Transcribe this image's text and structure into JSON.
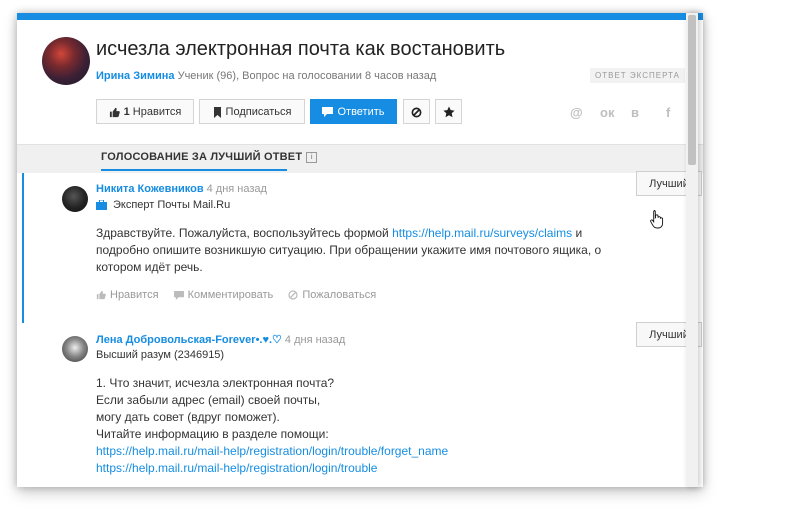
{
  "question": {
    "title": "исчезла электронная почта как востановить",
    "author": "Ирина Зимина",
    "meta": " Ученик (96), Вопрос на голосовании 8 часов назад",
    "expert_badge": "ОТВЕТ ЭКСПЕРТА"
  },
  "toolbar": {
    "like_count": "1",
    "like_label": " Нравится",
    "subscribe_label": "Подписаться",
    "answer_label": "Ответить"
  },
  "social": [
    "@",
    "ок",
    "в",
    "f"
  ],
  "vote_section": {
    "title": "ГОЛОСОВАНИЕ ЗА ЛУЧШИЙ ОТВЕТ",
    "info": "i"
  },
  "answers": [
    {
      "author": "Никита Кожевников",
      "time": "4 дня назад",
      "rank": "Эксперт Почты Mail.Ru",
      "body_prefix": "Здравствуйте. Пожалуйста, воспользуйтесь формой ",
      "link": "https://help.mail.ru/surveys/claims",
      "body_suffix": " и подробно опишите возникшую ситуацию. При обращении укажите имя почтового ящика, о котором идёт речь.",
      "best_label": "Лучший",
      "actions": {
        "like": "Нравится",
        "comment": "Комментировать",
        "report": "Пожаловаться"
      }
    },
    {
      "author": "Лена Добровольская-Forever•.♥.♡",
      "time": "4 дня назад",
      "rank": "Высший разум (2346915)",
      "lines": [
        "1. Что значит, исчезла электронная почта?",
        "Если забыли адрес (email) своей почты,",
        "могу дать совет (вдруг поможет).",
        "Читайте информацию в разделе помощи:"
      ],
      "links": [
        "https://help.mail.ru/mail-help/registration/login/trouble/forget_name",
        "https://help.mail.ru/mail-help/registration/login/trouble"
      ],
      "best_label": "Лучший"
    }
  ],
  "colors": {
    "accent": "#168de2",
    "text": "#333333",
    "muted": "#999999"
  }
}
